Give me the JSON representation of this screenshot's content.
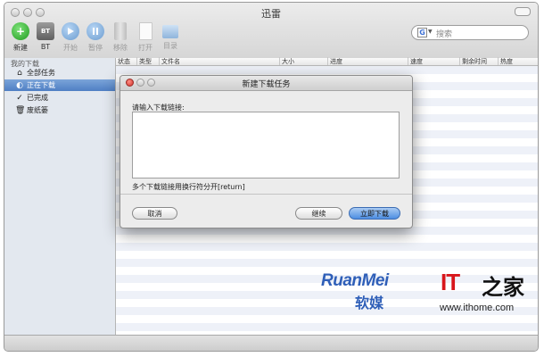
{
  "window": {
    "title": "迅雷"
  },
  "toolbar": {
    "new_label": "新建",
    "bt_label": "BT",
    "bt_badge": "BT",
    "start_label": "开始",
    "pause_label": "暂停",
    "remove_label": "移除",
    "open_label": "打开",
    "folder_label": "目录"
  },
  "search": {
    "placeholder": "搜索"
  },
  "sidebar": {
    "header": "我的下载",
    "items": [
      {
        "label": "全部任务",
        "icon": "home-icon"
      },
      {
        "label": "正在下载",
        "icon": "download-icon",
        "selected": true
      },
      {
        "label": "已完成",
        "icon": "check-icon"
      },
      {
        "label": "废纸篓",
        "icon": "trash-icon"
      }
    ]
  },
  "table": {
    "columns": [
      "状态",
      "类型",
      "文件名",
      "大小",
      "进度",
      "速度",
      "剩余时间",
      "热度"
    ]
  },
  "dialog": {
    "title": "新建下载任务",
    "prompt": "请输入下载链接:",
    "hint": "多个下载链接用换行符分开[return]",
    "cancel_label": "取消",
    "continue_label": "继续",
    "download_now_label": "立即下载"
  },
  "watermark": {
    "brand1": "RuanMei",
    "brand1_cn": "软媒",
    "brand2": "IT",
    "brand2_cn": "之家",
    "url": "www.ithome.com"
  }
}
